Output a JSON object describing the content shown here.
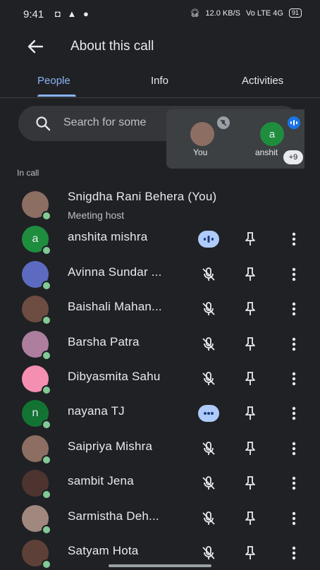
{
  "status": {
    "time": "9:41",
    "left_icons": "◘ ▲ ●",
    "network_speed": "12.0 KB/S",
    "network_labels": "Vo LTE 4G",
    "battery": "91"
  },
  "header": {
    "title": "About this call"
  },
  "tabs": [
    {
      "label": "People",
      "active": true
    },
    {
      "label": "Info",
      "active": false
    },
    {
      "label": "Activities",
      "active": false
    }
  ],
  "search": {
    "placeholder": "Search for some"
  },
  "tile_overlay": {
    "self_label": "You",
    "other_label": "anshit",
    "other_initial": "a",
    "extra_count": "+9"
  },
  "section_label": "In call",
  "participants": [
    {
      "name": "Snigdha Rani Behera (You)",
      "subtitle": "Meeting host",
      "initial": "",
      "avatar_color": "#8d6e63",
      "mic": "none"
    },
    {
      "name": "anshita mishra",
      "subtitle": "",
      "initial": "a",
      "avatar_color": "#1e8e3e",
      "mic": "speaking"
    },
    {
      "name": "Avinna Sundar ...",
      "subtitle": "",
      "initial": "",
      "avatar_color": "#5c6bc0",
      "mic": "muted"
    },
    {
      "name": "Baishali Mahan...",
      "subtitle": "",
      "initial": "",
      "avatar_color": "#6d4c41",
      "mic": "muted"
    },
    {
      "name": "Barsha Patra",
      "subtitle": "",
      "initial": "",
      "avatar_color": "#ad7e9e",
      "mic": "muted"
    },
    {
      "name": "Dibyasmita Sahu",
      "subtitle": "",
      "initial": "",
      "avatar_color": "#f48fb1",
      "mic": "muted"
    },
    {
      "name": "nayana TJ",
      "subtitle": "",
      "initial": "n",
      "avatar_color": "#137333",
      "mic": "active"
    },
    {
      "name": "Saipriya Mishra",
      "subtitle": "",
      "initial": "",
      "avatar_color": "#8d6e63",
      "mic": "muted"
    },
    {
      "name": "sambit Jena",
      "subtitle": "",
      "initial": "",
      "avatar_color": "#4e342e",
      "mic": "muted"
    },
    {
      "name": "Sarmistha Deh...",
      "subtitle": "",
      "initial": "",
      "avatar_color": "#a1887f",
      "mic": "muted"
    },
    {
      "name": "Satyam Hota",
      "subtitle": "",
      "initial": "",
      "avatar_color": "#5d4037",
      "mic": "muted"
    }
  ],
  "colors": {
    "background": "#202124",
    "accent": "#8ab4f8",
    "speaking_badge": "#aecbfa",
    "online_dot": "#81c995"
  },
  "icons": {
    "back": "arrow-left-icon",
    "search": "search-icon",
    "muted_mic": "mic-off-icon",
    "pin": "pin-icon",
    "more": "more-vert-icon",
    "speaking": "audio-level-icon"
  }
}
